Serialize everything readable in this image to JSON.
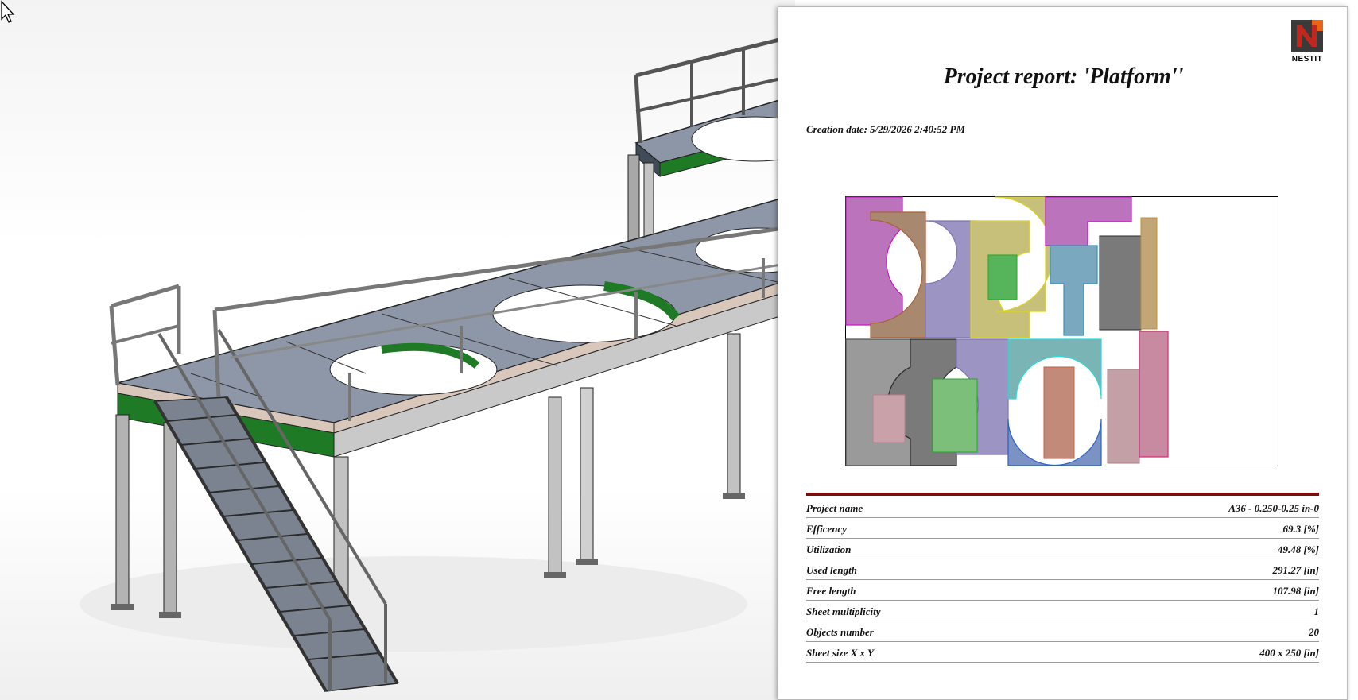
{
  "report": {
    "logo_text": "NESTIT",
    "title": "Project report: 'Platform''",
    "creation_date": "Creation date: 5/29/2026 2:40:52 PM",
    "rows": [
      {
        "label": "Project name",
        "value": "A36 - 0.250-0.25 in-0"
      },
      {
        "label": "Efficency",
        "value": "69.3 [%]"
      },
      {
        "label": "Utilization",
        "value": "49.48 [%]"
      },
      {
        "label": "Used length",
        "value": "291.27 [in]"
      },
      {
        "label": "Free length",
        "value": "107.98 [in]"
      },
      {
        "label": "Sheet multiplicity",
        "value": "1"
      },
      {
        "label": "Objects number",
        "value": "20"
      },
      {
        "label": "Sheet size X x Y",
        "value": "400 x 250 [in]"
      }
    ]
  },
  "colors": {
    "accent_rule": "#7a0e0e",
    "logo_dark": "#3a3a3a",
    "logo_red": "#c0271d",
    "logo_orange": "#e8641b"
  },
  "icons": [
    "mouse-cursor-icon",
    "nestit-logo-icon"
  ]
}
